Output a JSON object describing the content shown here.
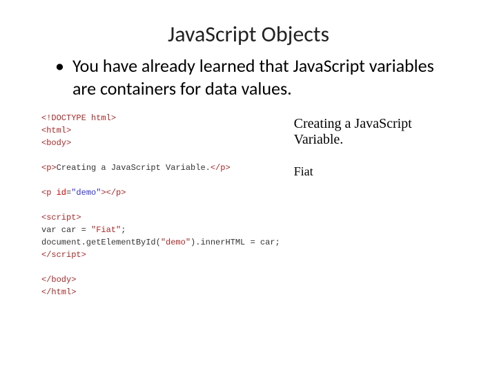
{
  "title": "JavaScript Objects",
  "bullet": "You have already learned that JavaScript variables are containers for data values.",
  "code": {
    "doctype": "<!DOCTYPE html>",
    "htmlOpen": "<html>",
    "bodyOpen": "<body>",
    "pOpen": "<p>",
    "pText": "Creating a JavaScript Variable.",
    "pClose": "</p>",
    "pDemoOpen1": "<p",
    "idAttr": " id",
    "equals": "=",
    "demoVal": "\"demo\"",
    "pDemoOpen2": ">",
    "pDemoClose": "</p>",
    "scriptOpen": "<script>",
    "varLine": "var car = ",
    "fiat": "\"Fiat\"",
    "semicolon": ";",
    "docLine": "document.getElementById(",
    "demoStr": "\"demo\"",
    "docLine2": ").innerHTML = car;",
    "scriptClose": "</script>",
    "bodyClose": "</body>",
    "htmlClose": "</html>"
  },
  "output": {
    "heading": "Creating a JavaScript Variable.",
    "value": "Fiat"
  }
}
